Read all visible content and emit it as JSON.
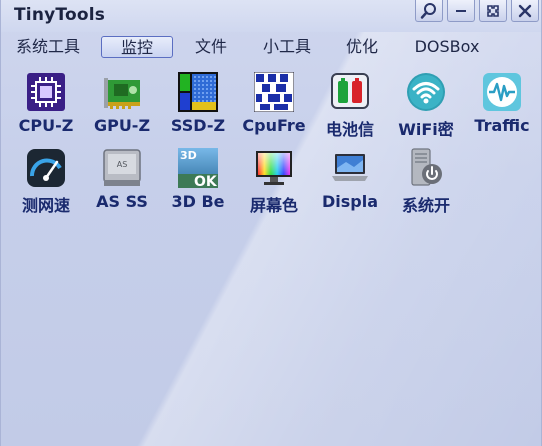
{
  "window": {
    "title": "TinyTools"
  },
  "menu": [
    {
      "label": "系统工具",
      "active": false
    },
    {
      "label": "监控",
      "active": true
    },
    {
      "label": "文件",
      "active": false
    },
    {
      "label": "小工具",
      "active": false
    },
    {
      "label": "优化",
      "active": false
    },
    {
      "label": "DOSBox",
      "active": false
    }
  ],
  "tools": [
    {
      "label": "CPU-Z",
      "icon": "cpu-z-icon"
    },
    {
      "label": "GPU-Z",
      "icon": "gpu-z-icon"
    },
    {
      "label": "SSD-Z",
      "icon": "ssd-z-icon"
    },
    {
      "label": "CpuFre",
      "icon": "cpu-frequency-icon"
    },
    {
      "label": "电池信",
      "icon": "battery-icon"
    },
    {
      "label": "WiFi密",
      "icon": "wifi-icon"
    },
    {
      "label": "Traffic",
      "icon": "traffic-monitor-icon"
    },
    {
      "label": "测网速",
      "icon": "speedometer-icon"
    },
    {
      "label": "AS SS",
      "icon": "as-ssd-icon"
    },
    {
      "label": "3D Be",
      "icon": "3d-benchmark-icon",
      "icon_text": [
        "3D",
        "OK"
      ]
    },
    {
      "label": "屏幕色",
      "icon": "screen-color-icon"
    },
    {
      "label": "Displa",
      "icon": "display-icon"
    },
    {
      "label": "系统开",
      "icon": "system-power-icon"
    }
  ]
}
